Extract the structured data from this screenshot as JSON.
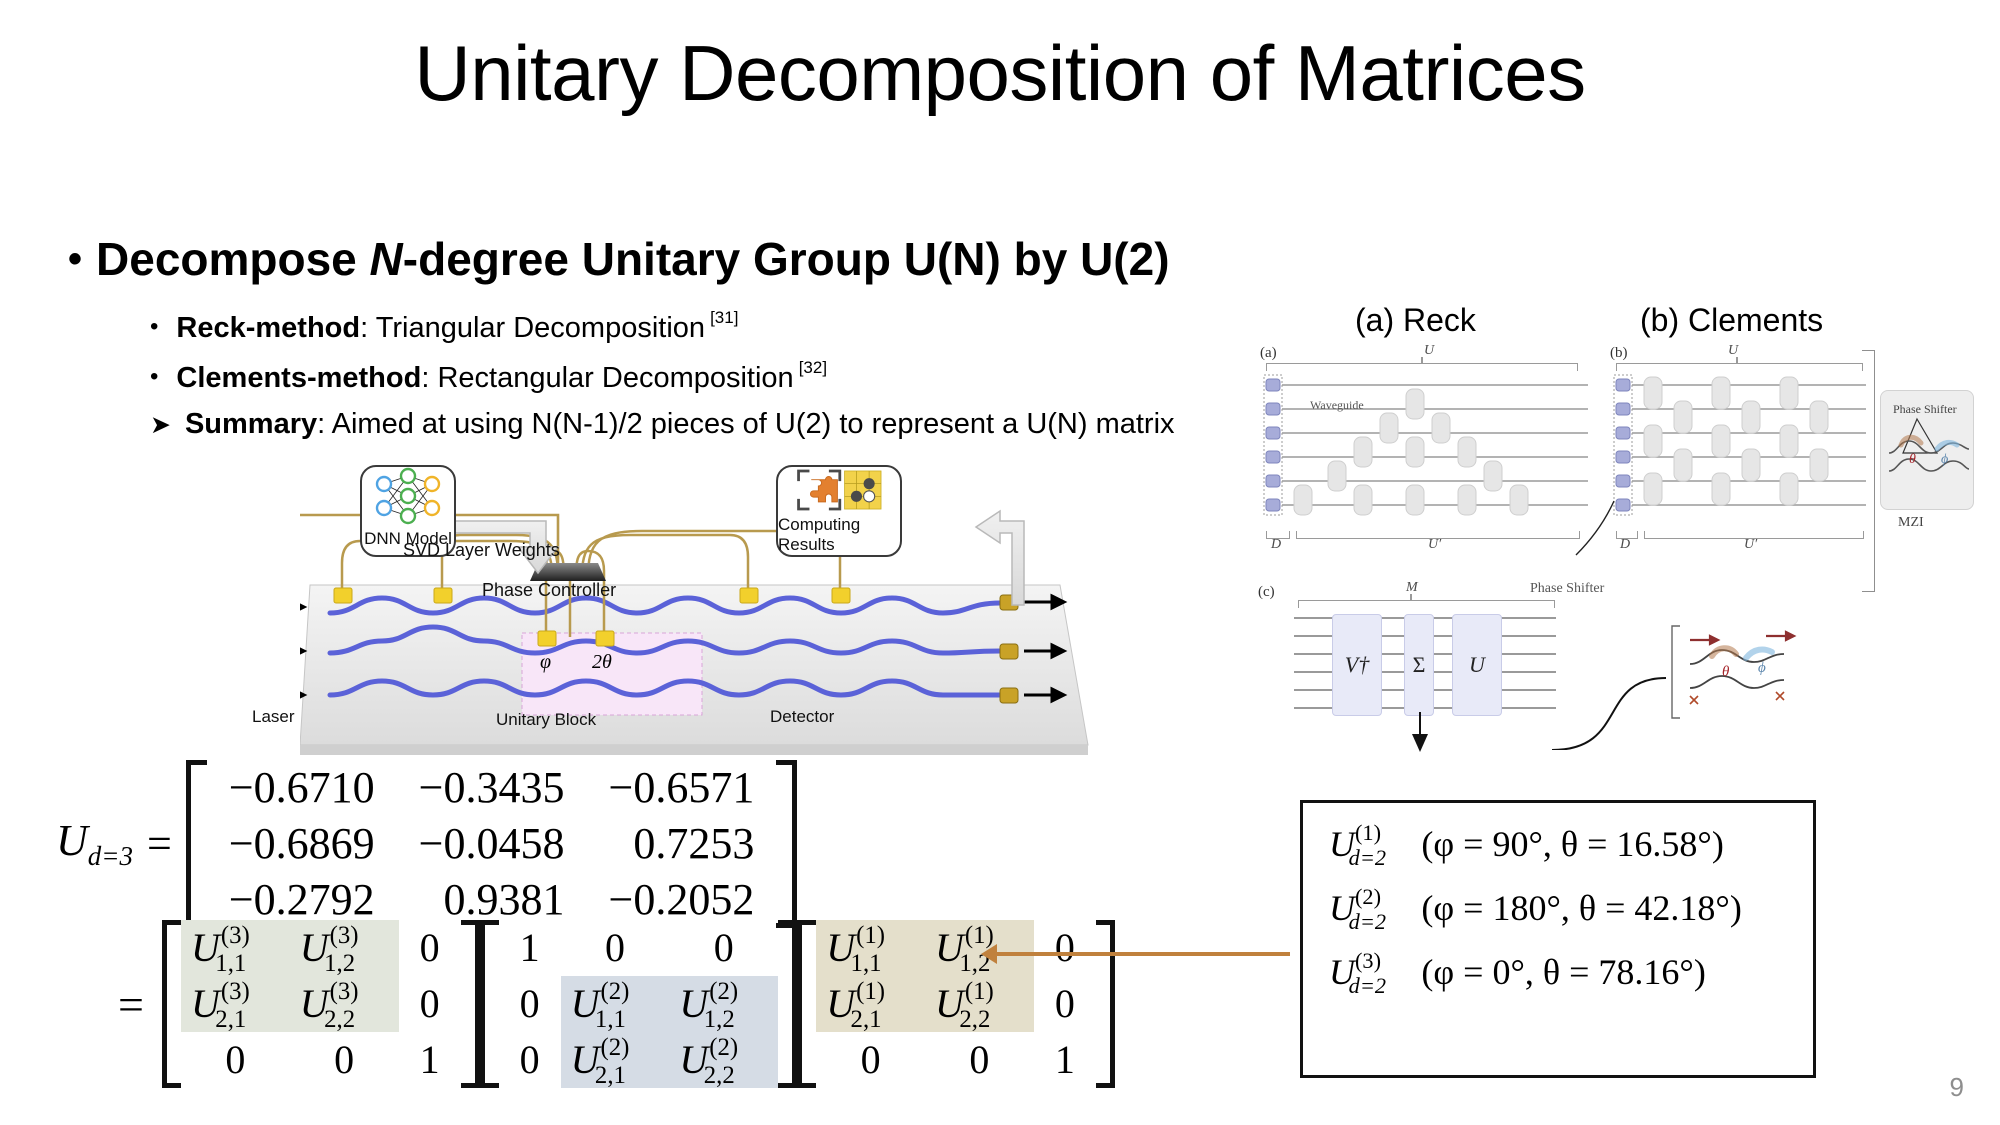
{
  "slide": {
    "title": "Unitary Decomposition of Matrices",
    "page_number": "9"
  },
  "bullets": {
    "level1": {
      "marker": "•",
      "text_before": "Decompose ",
      "italic": "N",
      "text_after": "-degree Unitary Group U(N) by U(2)"
    },
    "items": [
      {
        "marker": "•",
        "bold": "Reck-method",
        "text": ": Triangular Decomposition",
        "ref": "[31]"
      },
      {
        "marker": "•",
        "bold": "Clements-method",
        "text": ": Rectangular Decomposition",
        "ref": "[32]"
      },
      {
        "marker": "➤",
        "bold": "Summary",
        "text": ": Aimed at using N(N-1)/2 pieces of U(2) to represent a U(N) matrix",
        "ref": ""
      }
    ]
  },
  "chip_diagram": {
    "dnn_label": "DNN Model",
    "svd_arrow_label": "SVD Layer Weights",
    "phase_controller_label": "Phase Controller",
    "computing_results_label": "Computing Results",
    "laser_label": "Laser",
    "unitary_block_label": "Unitary Block",
    "detector_label": "Detector",
    "phi_label": "φ",
    "theta_label": "2θ",
    "colors": {
      "waveguide": "#5b62d8",
      "heater": "#f2d02c",
      "wire": "#b89a4e",
      "dnn_input": "#4fa3e3",
      "dnn_hidden": "#4caf50",
      "dnn_output": "#f0b429",
      "puzzle": "#e3802f",
      "board": "#f2d24a",
      "unitary_highlight": "#f7e3f7"
    }
  },
  "right_figures": {
    "heading_a": "(a) Reck",
    "heading_b": "(b) Clements",
    "panel_a": {
      "tag": "(a)",
      "top_bracket": "U",
      "waveguide_label": "Waveguide",
      "bottom_left": "D",
      "bottom_right": "U′"
    },
    "panel_b": {
      "tag": "(b)",
      "top_bracket": "U",
      "bottom_left": "D",
      "bottom_right": "U′"
    },
    "phase_shifter_label": "Phase Shifter",
    "mzi_inset": {
      "title": "Phase Shifter",
      "theta": "θ",
      "phi": "ϕ",
      "caption": "MZI"
    },
    "panel_c": {
      "tag": "(c)",
      "top_bracket": "M",
      "blocks": [
        "V†",
        "Σ",
        "U"
      ],
      "mzi_theta": "θ",
      "mzi_phi": "ϕ"
    }
  },
  "equation_u3": {
    "lhs_symbol": "U",
    "lhs_sub": "d=3",
    "equals": "=",
    "matrix": [
      [
        "−0.6710",
        "−0.3435",
        "−0.6571"
      ],
      [
        "−0.6869",
        "−0.0458",
        "0.7253"
      ],
      [
        "−0.2792",
        "0.9381",
        "−0.2052"
      ]
    ]
  },
  "decomposition": {
    "equals": "=",
    "factors": [
      {
        "highlight": "green",
        "highlight_color": "#e2e6dc",
        "superscript": "(3)",
        "cells": [
          [
            "U 1,1 (3)",
            "U 1,2 (3)",
            "0"
          ],
          [
            "U 2,1 (3)",
            "U 2,2 (3)",
            "0"
          ],
          [
            "0",
            "0",
            "1"
          ]
        ]
      },
      {
        "highlight": "blue",
        "highlight_color": "#d5dce5",
        "superscript": "(2)",
        "cells": [
          [
            "1",
            "0",
            "0"
          ],
          [
            "0",
            "U 1,1 (2)",
            "U 1,2 (2)"
          ],
          [
            "0",
            "U 2,1 (2)",
            "U 2,2 (2)"
          ]
        ]
      },
      {
        "highlight": "tan",
        "highlight_color": "#e4dfcb",
        "superscript": "(1)",
        "cells": [
          [
            "U 1,1 (1)",
            "U 1,2 (1)",
            "0"
          ],
          [
            "U 2,1 (1)",
            "U 2,2 (1)",
            "0"
          ],
          [
            "0",
            "0",
            "1"
          ]
        ]
      }
    ],
    "arrow_color": "#c0813d"
  },
  "param_box": {
    "border_color": "#111111",
    "lines": [
      {
        "symbol": "U",
        "sup": "(1)",
        "sub": "d=2",
        "params": "(φ = 90°, θ = 16.58°)"
      },
      {
        "symbol": "U",
        "sup": "(2)",
        "sub": "d=2",
        "params": "(φ = 180°, θ = 42.18°)"
      },
      {
        "symbol": "U",
        "sup": "(3)",
        "sub": "d=2",
        "params": "(φ = 0°, θ = 78.16°)"
      }
    ]
  }
}
